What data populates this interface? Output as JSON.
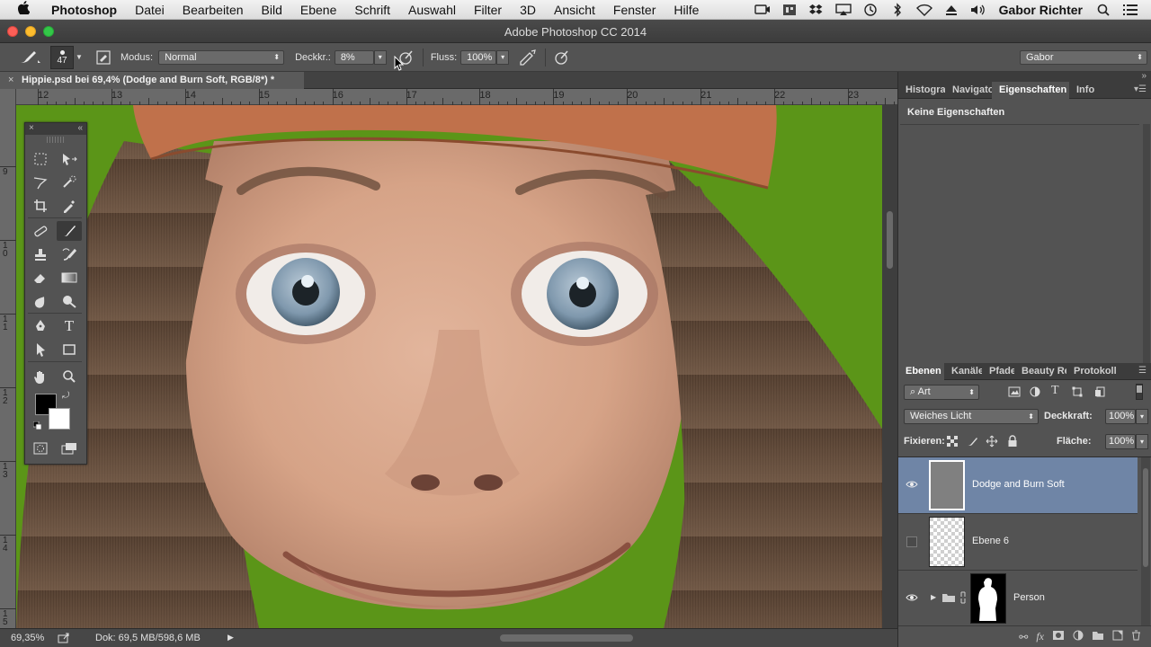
{
  "menubar": {
    "apple": "",
    "app": "Photoshop",
    "items": [
      "Datei",
      "Bearbeiten",
      "Bild",
      "Ebene",
      "Schrift",
      "Auswahl",
      "Filter",
      "3D",
      "Ansicht",
      "Fenster",
      "Hilfe"
    ],
    "user": "Gabor Richter"
  },
  "window": {
    "title": "Adobe Photoshop CC 2014"
  },
  "options": {
    "brush_size": "47",
    "mode_label": "Modus:",
    "mode_value": "Normal",
    "opacity_label": "Deckkr.:",
    "opacity_value": "8%",
    "flow_label": "Fluss:",
    "flow_value": "100%",
    "workspace": "Gabor"
  },
  "document": {
    "tab_title": "Hippie.psd bei 69,4% (Dodge and Burn Soft, RGB/8*) *",
    "close": "×"
  },
  "ruler": {
    "h_labels": [
      "12",
      "13",
      "14",
      "15",
      "16",
      "17",
      "18",
      "19",
      "20",
      "21",
      "22",
      "23"
    ],
    "v_labels": [
      "9",
      "1\n0",
      "1\n1",
      "1\n2",
      "1\n3",
      "1\n4",
      "1\n5"
    ]
  },
  "status": {
    "zoom": "69,35%",
    "doc_size": "Dok: 69,5 MB/598,6 MB"
  },
  "properties_panel": {
    "tabs": [
      "Histogra",
      "Navigato",
      "Eigenschaften",
      "Info"
    ],
    "active_tab": "Eigenschaften",
    "empty_text": "Keine Eigenschaften"
  },
  "layers_panel": {
    "tabs": [
      "Ebenen",
      "Kanäle",
      "Pfade",
      "Beauty Rei",
      "Protokoll"
    ],
    "active_tab": "Ebenen",
    "filter_kind": "Art",
    "blend_mode": "Weiches Licht",
    "opacity_label": "Deckkraft:",
    "opacity_value": "100%",
    "lock_label": "Fixieren:",
    "fill_label": "Fläche:",
    "fill_value": "100%",
    "layers": [
      {
        "name": "Dodge and Burn Soft",
        "visible": true,
        "selected": true
      },
      {
        "name": "Ebene 6",
        "visible": false,
        "selected": false
      },
      {
        "name": "Person",
        "visible": true,
        "selected": false
      }
    ]
  }
}
